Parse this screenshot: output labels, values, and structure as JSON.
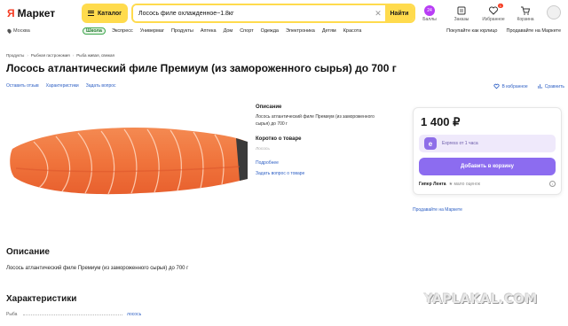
{
  "header": {
    "logo_mark": "Я",
    "logo_text": "Маркет",
    "catalog_label": "Каталог",
    "search_value": "Лосось филе охлажденное~1.8кг",
    "search_button": "Найти",
    "bonus_count": "24",
    "icons": [
      {
        "label": "Баллы",
        "icon": "bonus-icon"
      },
      {
        "label": "Заказы",
        "icon": "orders-icon"
      },
      {
        "label": "Избранное",
        "icon": "heart-icon",
        "badge": "1"
      },
      {
        "label": "Корзина",
        "icon": "cart-icon"
      }
    ]
  },
  "nav": {
    "location": "Москва",
    "school": "Школа",
    "items": [
      "Экспресс",
      "Универмаг",
      "Продукты",
      "Аптека",
      "Дом",
      "Спорт",
      "Одежда",
      "Электроника",
      "Детям",
      "Красота"
    ],
    "right": [
      "Покупайте как юрлицо",
      "Продавайте на Маркете"
    ]
  },
  "breadcrumbs": [
    "Продукты",
    "Рыбная гастрономия",
    "Рыба живая, свежая"
  ],
  "product": {
    "title": "Лосось атлантический филе Премиум (из замороженного сырья) до 700 г",
    "actions": [
      "Оставить отзыв",
      "Характеристики",
      "Задать вопрос"
    ],
    "right_actions": [
      "В избранное",
      "Сравнить"
    ]
  },
  "description_col": {
    "heading": "Описание",
    "text": "Лосось атлантический филе Премиум (из замороженного сырья) до 700 г",
    "brief_heading": "Коротко о товаре",
    "brief_item": "Лосось",
    "more_link": "Подробнее",
    "ask_link": "Задать вопрос о товаре"
  },
  "buy_box": {
    "price": "1 400 ₽",
    "express": "Express от 1 часа",
    "cart_button": "Добавить в корзину",
    "seller": "Гипер Лента",
    "rating": "мало оценок",
    "sell_link": "Продавайте на Маркете"
  },
  "sections": {
    "description_heading": "Описание",
    "description_text": "Лосось атлантический филе Премиум (из замороженного сырья) до 700 г",
    "chars_heading": "Характеристики",
    "char_label": "Рыба",
    "char_value": "лосось"
  },
  "watermark": "YAPLAKAL.COM",
  "colors": {
    "accent_yellow": "#ffdb4d",
    "cart_purple": "#8c6cf0",
    "link_blue": "#2d5fc4",
    "brand_red": "#f53b22"
  }
}
